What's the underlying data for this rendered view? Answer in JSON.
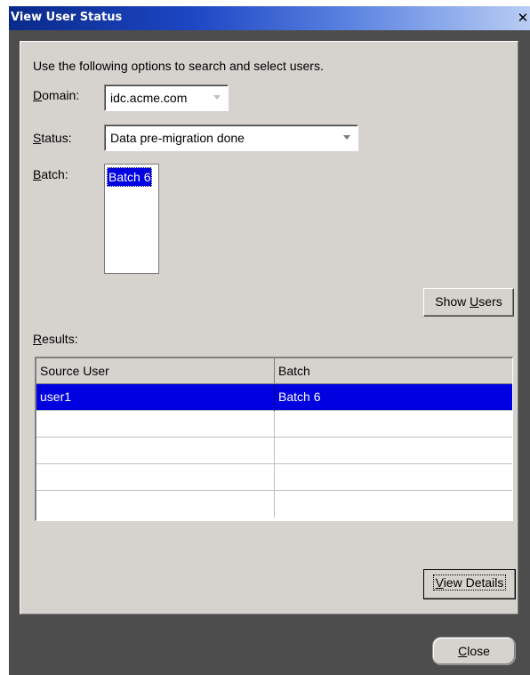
{
  "window": {
    "title": "View User Status",
    "close_glyph": "✕"
  },
  "form": {
    "instructions": "Use the following options to search and select users.",
    "domain_label_key": "D",
    "domain_label_rest": "omain:",
    "domain_value": "idc.acme.com",
    "status_label_key": "S",
    "status_label_rest": "tatus:",
    "status_value": "Data pre-migration done",
    "batch_label_key": "B",
    "batch_label_rest": "atch:",
    "batch_items": [
      "Batch 6"
    ],
    "show_users_pre": "Show ",
    "show_users_key": "U",
    "show_users_post": "sers"
  },
  "results": {
    "label_key": "R",
    "label_rest": "esults:",
    "columns": [
      "Source User",
      "Batch"
    ],
    "rows": [
      [
        "user1",
        "Batch 6"
      ],
      [
        "",
        ""
      ],
      [
        "",
        ""
      ],
      [
        "",
        ""
      ],
      [
        "",
        ""
      ]
    ],
    "view_details_key": "V",
    "view_details_rest": "iew Details"
  },
  "footer": {
    "close_key": "C",
    "close_rest": "lose"
  },
  "colors": {
    "selection": "#0000e0",
    "panel": "#d6d3ce",
    "titlebar": "#0a2a8a"
  }
}
